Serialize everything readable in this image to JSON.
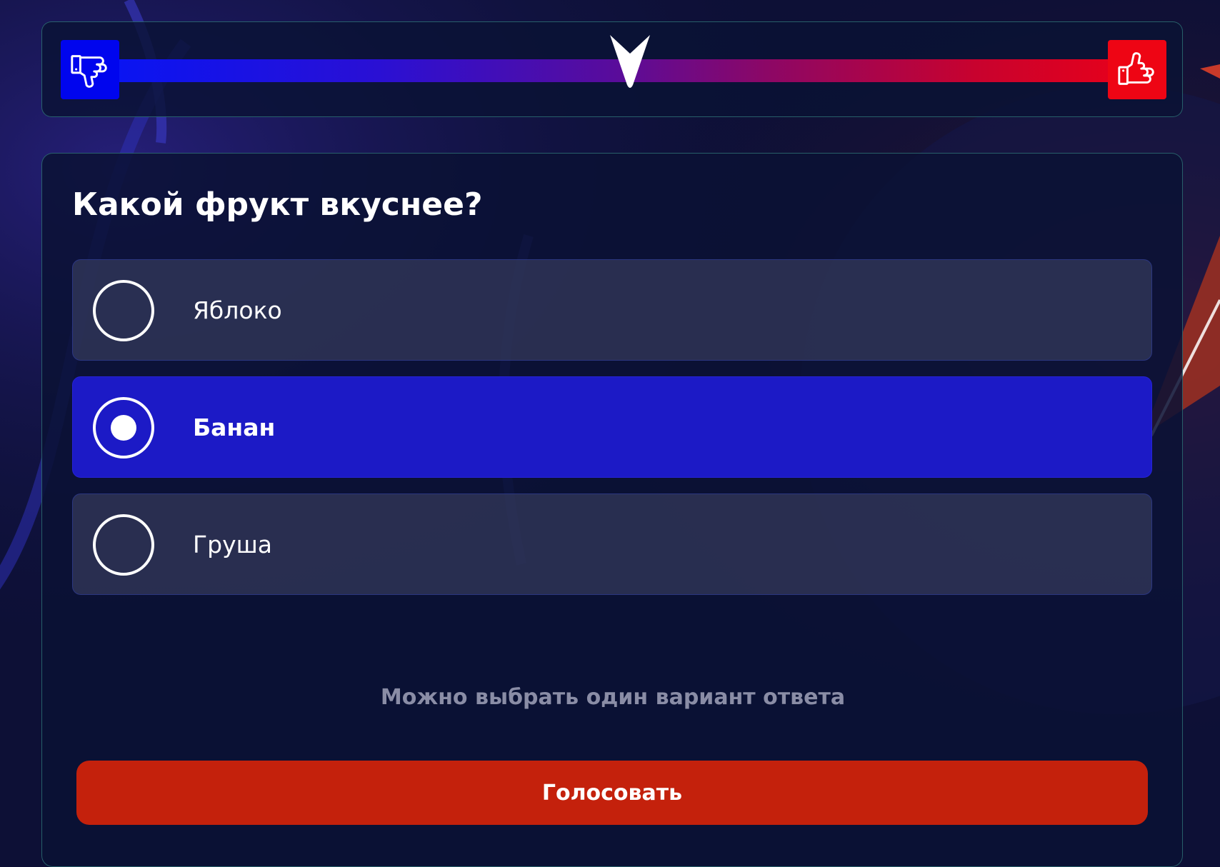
{
  "rating": {
    "marker_position": 0.49,
    "low_icon": "thumbs-down-icon",
    "high_icon": "thumbs-up-icon",
    "colors": {
      "low": "#0005ee",
      "high": "#ee0514"
    }
  },
  "poll": {
    "question": "Какой фрукт вкуснее?",
    "options": [
      {
        "label": "Яблоко",
        "selected": false
      },
      {
        "label": "Банан",
        "selected": true
      },
      {
        "label": "Груша",
        "selected": false
      }
    ],
    "hint": "Можно выбрать один вариант ответа",
    "vote_label": "Голосовать"
  },
  "colors": {
    "background": "#0d1036",
    "selected_option": "#1c1ac6",
    "vote_button": "#c4210c",
    "hint_text": "#8a8da6"
  }
}
